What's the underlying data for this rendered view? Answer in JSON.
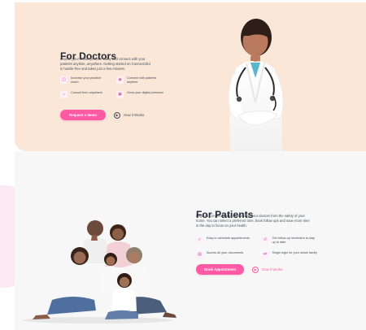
{
  "doctor_section": {
    "title": "For Doctors",
    "description": "Launch your online practice today and connect with your patients anytime, anywhere. Getting started on Connect2Ed is hassle-free and takes just a few minutes.",
    "features": [
      {
        "icon": "calendar-plus-icon",
        "label": "Increase your practice reach"
      },
      {
        "icon": "patient-icon",
        "label": "Connect with patients anytime"
      },
      {
        "icon": "clinic-icon",
        "label": "Consult from anywhere"
      },
      {
        "icon": "wallet-icon",
        "label": "Grow your digital presence"
      }
    ],
    "primary_cta": "Request a demo",
    "secondary_cta": "How it Works"
  },
  "patient_section": {
    "title": "For Patients",
    "description": "Login to Connect2Ed to consult with your doctors from the safety of your home. You can select a preferred time, book follow ups and save more time in the day to focus on your health.",
    "features": [
      {
        "icon": "calendar-check-icon",
        "label": "Easy to schedule appointments"
      },
      {
        "icon": "history-icon",
        "label": "Get follow-up reminders to stay up to date"
      },
      {
        "icon": "documents-icon",
        "label": "Access all your documents"
      },
      {
        "icon": "login-icon",
        "label": "Single login for your whole family"
      }
    ],
    "primary_cta": "Book Appointment",
    "secondary_cta": "How it Works"
  },
  "colors": {
    "doctor_bg": "#fae7d8",
    "patient_bg": "#f7f7f7",
    "brand_pink": "#ff5aa3",
    "text_dark": "#1f2430",
    "text_muted": "#4a4f59"
  }
}
